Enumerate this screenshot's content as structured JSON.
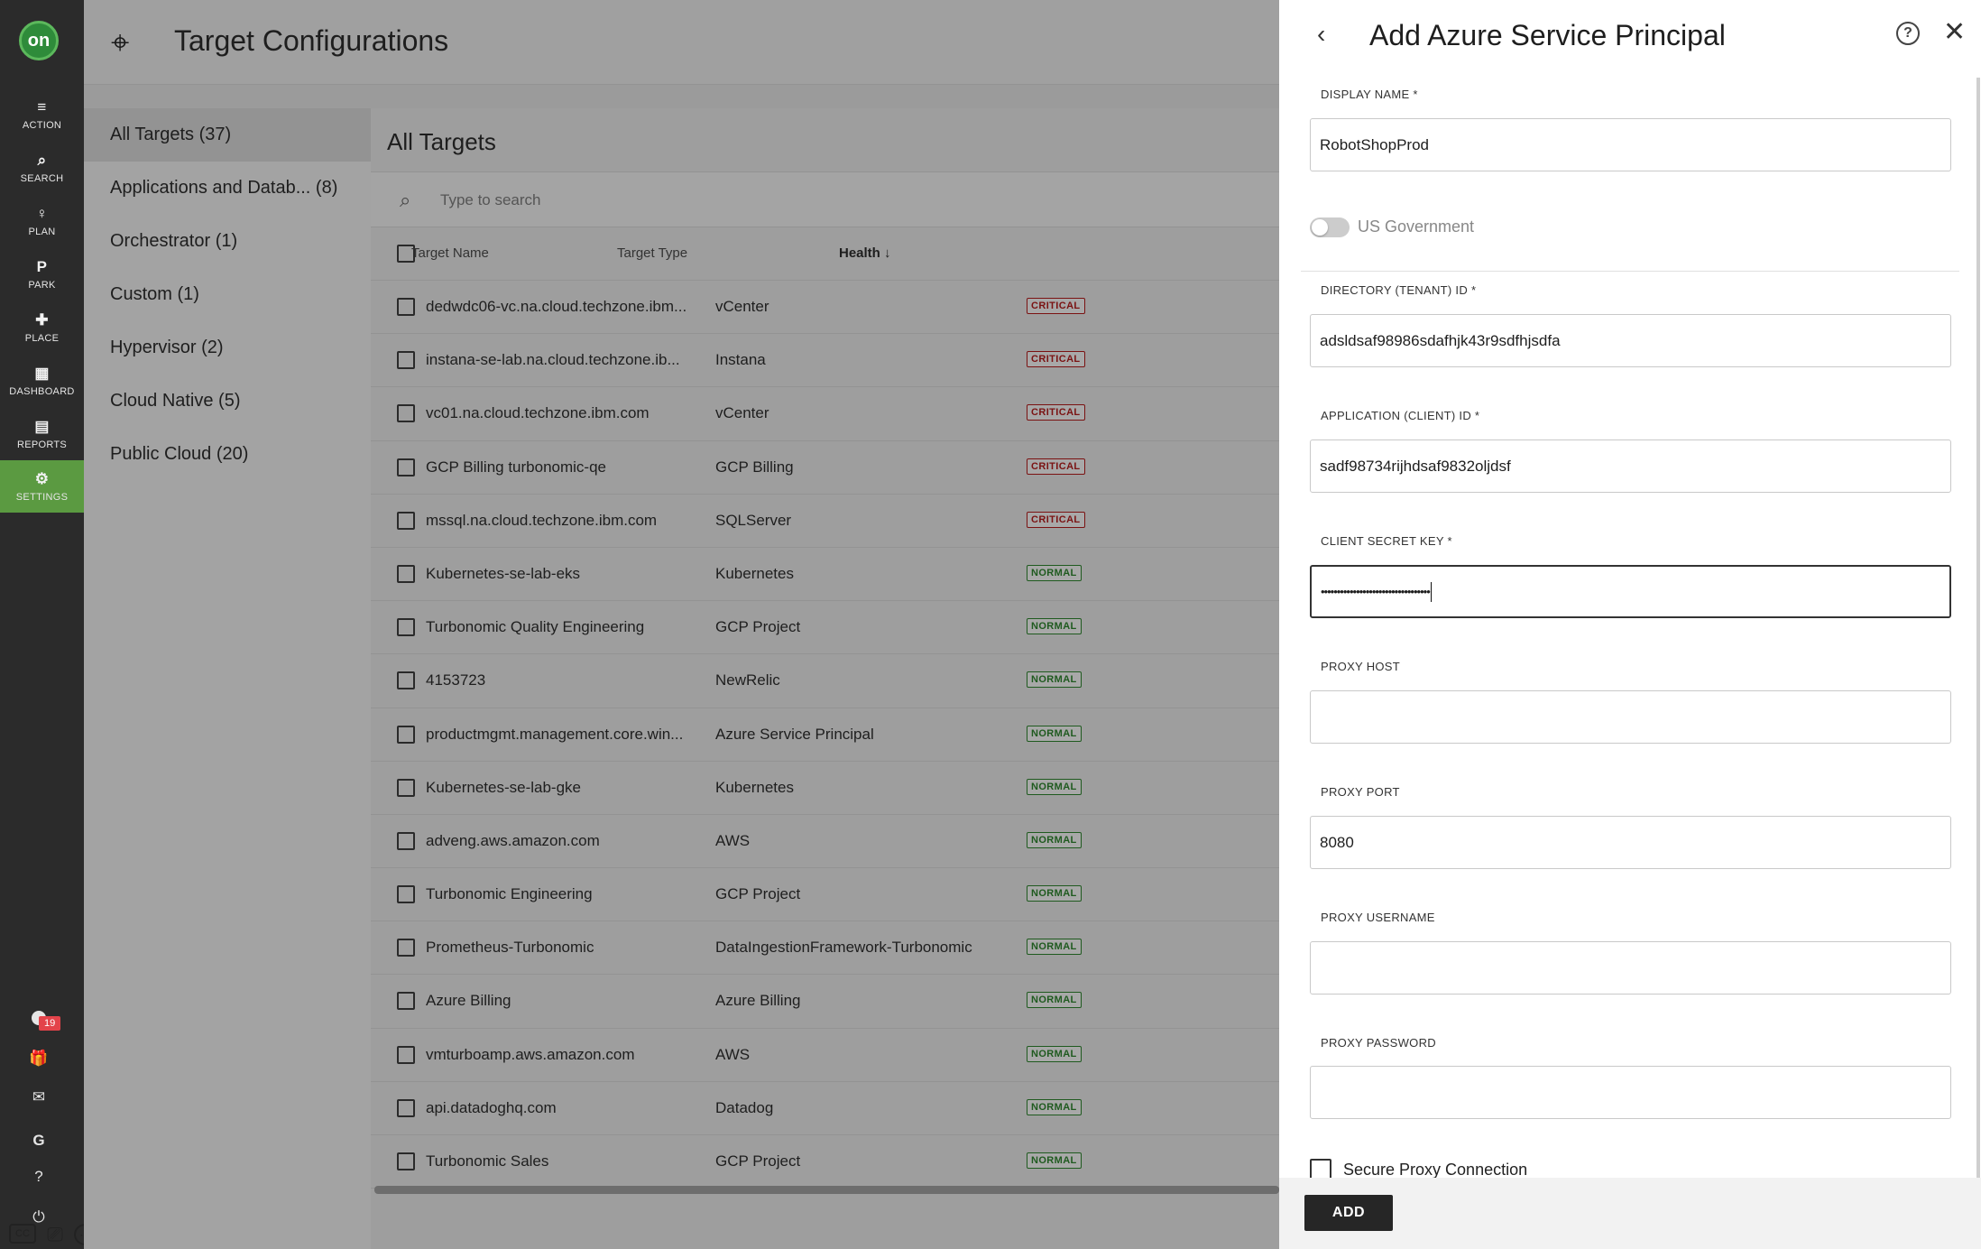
{
  "nav": {
    "logo": "on",
    "items": [
      {
        "icon": "≡",
        "label": "ACTION"
      },
      {
        "icon": "⌕",
        "label": "SEARCH"
      },
      {
        "icon": "♀",
        "label": "PLAN"
      },
      {
        "icon": "P",
        "label": "PARK"
      },
      {
        "icon": "✚",
        "label": "PLACE"
      },
      {
        "icon": "▦",
        "label": "DASHBOARD"
      },
      {
        "icon": "▤",
        "label": "REPORTS"
      },
      {
        "icon": "⚙",
        "label": "SETTINGS"
      }
    ],
    "notification_count": "19",
    "accent_color": "#5b9a41"
  },
  "header": {
    "title": "Target Configurations"
  },
  "categories": [
    "All Targets (37)",
    "Applications and Datab... (8)",
    "Orchestrator (1)",
    "Custom (1)",
    "Hypervisor (2)",
    "Cloud Native (5)",
    "Public Cloud (20)"
  ],
  "targets": {
    "heading": "All Targets",
    "search_placeholder": "Type to search",
    "columns": {
      "name": "Target Name",
      "type": "Target Type",
      "health": "Health ↓"
    },
    "rows": [
      {
        "name": "dedwdc06-vc.na.cloud.techzone.ibm...",
        "type": "vCenter",
        "health": "CRITICAL"
      },
      {
        "name": "instana-se-lab.na.cloud.techzone.ib...",
        "type": "Instana",
        "health": "CRITICAL"
      },
      {
        "name": "vc01.na.cloud.techzone.ibm.com",
        "type": "vCenter",
        "health": "CRITICAL"
      },
      {
        "name": "GCP Billing turbonomic-qe",
        "type": "GCP Billing",
        "health": "CRITICAL"
      },
      {
        "name": "mssql.na.cloud.techzone.ibm.com",
        "type": "SQLServer",
        "health": "CRITICAL"
      },
      {
        "name": "Kubernetes-se-lab-eks",
        "type": "Kubernetes",
        "health": "NORMAL"
      },
      {
        "name": "Turbonomic Quality Engineering",
        "type": "GCP Project",
        "health": "NORMAL"
      },
      {
        "name": "4153723",
        "type": "NewRelic",
        "health": "NORMAL"
      },
      {
        "name": "productmgmt.management.core.win...",
        "type": "Azure Service Principal",
        "health": "NORMAL"
      },
      {
        "name": "Kubernetes-se-lab-gke",
        "type": "Kubernetes",
        "health": "NORMAL"
      },
      {
        "name": "adveng.aws.amazon.com",
        "type": "AWS",
        "health": "NORMAL"
      },
      {
        "name": "Turbonomic Engineering",
        "type": "GCP Project",
        "health": "NORMAL"
      },
      {
        "name": "Prometheus-Turbonomic",
        "type": "DataIngestionFramework-Turbonomic",
        "health": "NORMAL"
      },
      {
        "name": "Azure Billing",
        "type": "Azure Billing",
        "health": "NORMAL"
      },
      {
        "name": "vmturboamp.aws.amazon.com",
        "type": "AWS",
        "health": "NORMAL"
      },
      {
        "name": "api.datadoghq.com",
        "type": "Datadog",
        "health": "NORMAL"
      },
      {
        "name": "Turbonomic Sales",
        "type": "GCP Project",
        "health": "NORMAL"
      }
    ]
  },
  "drawer": {
    "title": "Add Azure Service Principal",
    "display_name": {
      "label": "DISPLAY NAME *",
      "value": "RobotShopProd"
    },
    "us_government": {
      "label": "US Government",
      "enabled": false
    },
    "tenant_id": {
      "label": "DIRECTORY (TENANT) ID *",
      "value": "adsldsaf98986sdafhjk43r9sdfhjsdfa"
    },
    "client_id": {
      "label": "APPLICATION (CLIENT) ID *",
      "value": "sadf98734rijhdsaf9832oljdsf"
    },
    "client_secret": {
      "label": "CLIENT SECRET KEY *",
      "value": "••••••••••••••••••••••••••••••••••"
    },
    "proxy_host": {
      "label": "PROXY HOST",
      "value": ""
    },
    "proxy_port": {
      "label": "PROXY PORT",
      "value": "8080"
    },
    "proxy_username": {
      "label": "PROXY USERNAME",
      "value": ""
    },
    "proxy_password": {
      "label": "PROXY PASSWORD",
      "value": ""
    },
    "secure_proxy": {
      "label": "Secure Proxy Connection",
      "checked": false
    },
    "add_label": "ADD"
  },
  "colors": {
    "critical": "#7a1212",
    "normal": "#1f5a1f",
    "dim_overlay": "#9e9e9e"
  }
}
